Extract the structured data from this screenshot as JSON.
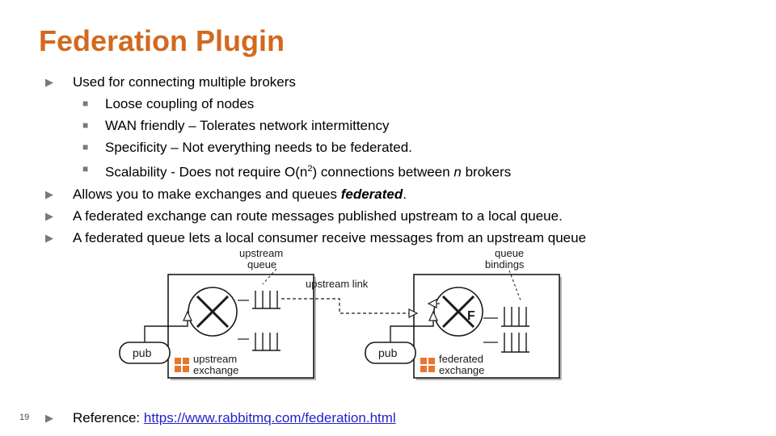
{
  "slide": {
    "title": "Federation Plugin",
    "number": "19",
    "bullet_glyph": "▶",
    "sub_bullet_glyph": "■",
    "accent_color": "#d2691e",
    "bullet_color": "#7b7b6a",
    "link_color": "#2222cc"
  },
  "content": {
    "items": [
      {
        "text": "Used for connecting multiple brokers"
      },
      {
        "text": "Allows you to make exchanges and queues "
      },
      {
        "text": "A federated exchange can route messages published upstream to a local queue."
      },
      {
        "text": "A federated queue lets a local consumer receive messages from an upstream queue"
      }
    ],
    "item2_emphasis": "federated",
    "item2_tail": ".",
    "sub_items": [
      {
        "text": "Loose coupling of nodes"
      },
      {
        "text": "WAN friendly – Tolerates network intermittency"
      },
      {
        "text": "Specificity – Not everything needs to be federated."
      },
      {
        "prefix": "Scalability - Does not require O(n",
        "superscript": "2",
        "middle": ") connections between ",
        "italic": "n",
        "suffix": " brokers"
      }
    ]
  },
  "footer": {
    "reference_label": "Reference: ",
    "reference_link": "https://www.rabbitmq.com/federation.html"
  },
  "diagram": {
    "labels": {
      "upstream_queue": "upstream",
      "upstream_queue_2": "queue",
      "queue_bindings": "queue",
      "queue_bindings_2": "bindings",
      "upstream_link": "upstream link",
      "pub_left": "pub",
      "pub_right": "pub",
      "upstream_exchange": "upstream",
      "upstream_exchange_2": "exchange",
      "federated_exchange": "federated",
      "federated_exchange_2": "exchange",
      "exchange_letter": "F"
    },
    "colors": {
      "box_fill": "#ffffff",
      "box_stroke": "#1a1a1a",
      "icon_orange": "#e8762c",
      "shadow": "#b8b8b8"
    }
  }
}
